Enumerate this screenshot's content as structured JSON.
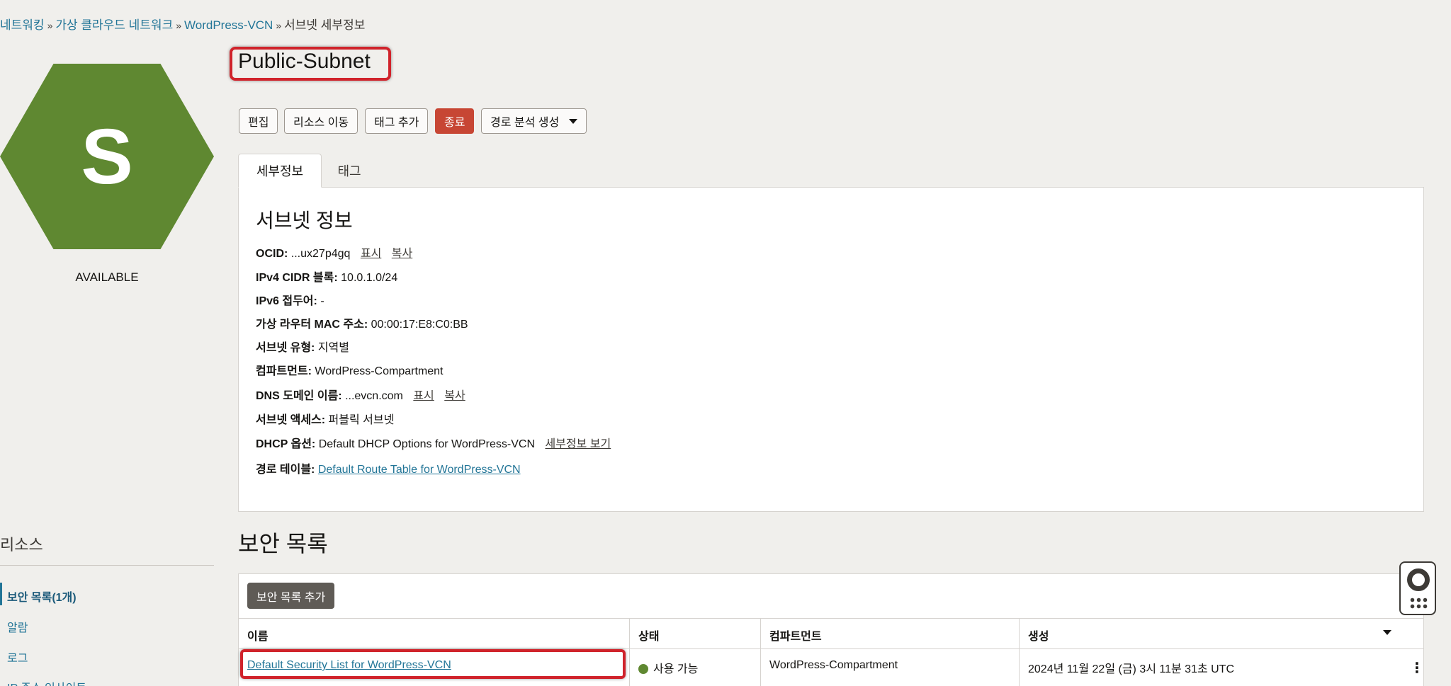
{
  "breadcrumb": {
    "item1": "네트워킹",
    "item2": "가상 클라우드 네트워크",
    "item3": "WordPress-VCN",
    "current": "서브넷 세부정보",
    "separator": "»"
  },
  "resource": {
    "letter": "S",
    "status": "AVAILABLE",
    "color": "#5f8831",
    "title": "Public-Subnet"
  },
  "actions": {
    "edit": "편집",
    "move": "리소스 이동",
    "add_tag": "태그 추가",
    "terminate": "종료",
    "path_analysis": "경로 분석 생성"
  },
  "tabs": {
    "details": "세부정보",
    "tags": "태그"
  },
  "info": {
    "heading": "서브넷 정보",
    "ocid_label": "OCID:",
    "ocid_value": "...ux27p4gq",
    "show": "표시",
    "copy": "복사",
    "ipv4_label": "IPv4 CIDR 블록:",
    "ipv4_value": "10.0.1.0/24",
    "ipv6_label": "IPv6 접두어:",
    "ipv6_value": "-",
    "mac_label": "가상 라우터 MAC 주소:",
    "mac_value": "00:00:17:E8:C0:BB",
    "type_label": "서브넷 유형:",
    "type_value": "지역별",
    "compartment_label": "컴파트먼트:",
    "compartment_value": "WordPress-Compartment",
    "dns_label": "DNS 도메인 이름:",
    "dns_value": "...evcn.com",
    "access_label": "서브넷 액세스:",
    "access_value": "퍼블릭 서브넷",
    "dhcp_label": "DHCP 옵션:",
    "dhcp_value": "Default DHCP Options for WordPress-VCN",
    "dhcp_link": "세부정보 보기",
    "route_label": "경로 테이블:",
    "route_value": "Default Route Table for WordPress-VCN"
  },
  "resources_nav": {
    "title": "리소스",
    "security_lists": "보안 목록(1개)",
    "alarms": "알람",
    "logs": "로그",
    "ip_insights": "IP 주소 인사이트"
  },
  "security_lists": {
    "heading": "보안 목록",
    "add_button": "보안 목록 추가",
    "columns": {
      "name": "이름",
      "state": "상태",
      "compartment": "컴파트먼트",
      "created": "생성"
    },
    "rows": [
      {
        "name": "Default Security List for WordPress-VCN",
        "state": "사용 가능",
        "compartment": "WordPress-Compartment",
        "created": "2024년 11월 22일 (금) 3시 11분 31초 UTC"
      }
    ]
  },
  "icons": {
    "help": "lifebuoy-icon",
    "apps": "grid-icon",
    "row_menu": "kebab-menu-icon",
    "sort": "caret-down-icon",
    "status_dot": "status-dot-icon"
  }
}
